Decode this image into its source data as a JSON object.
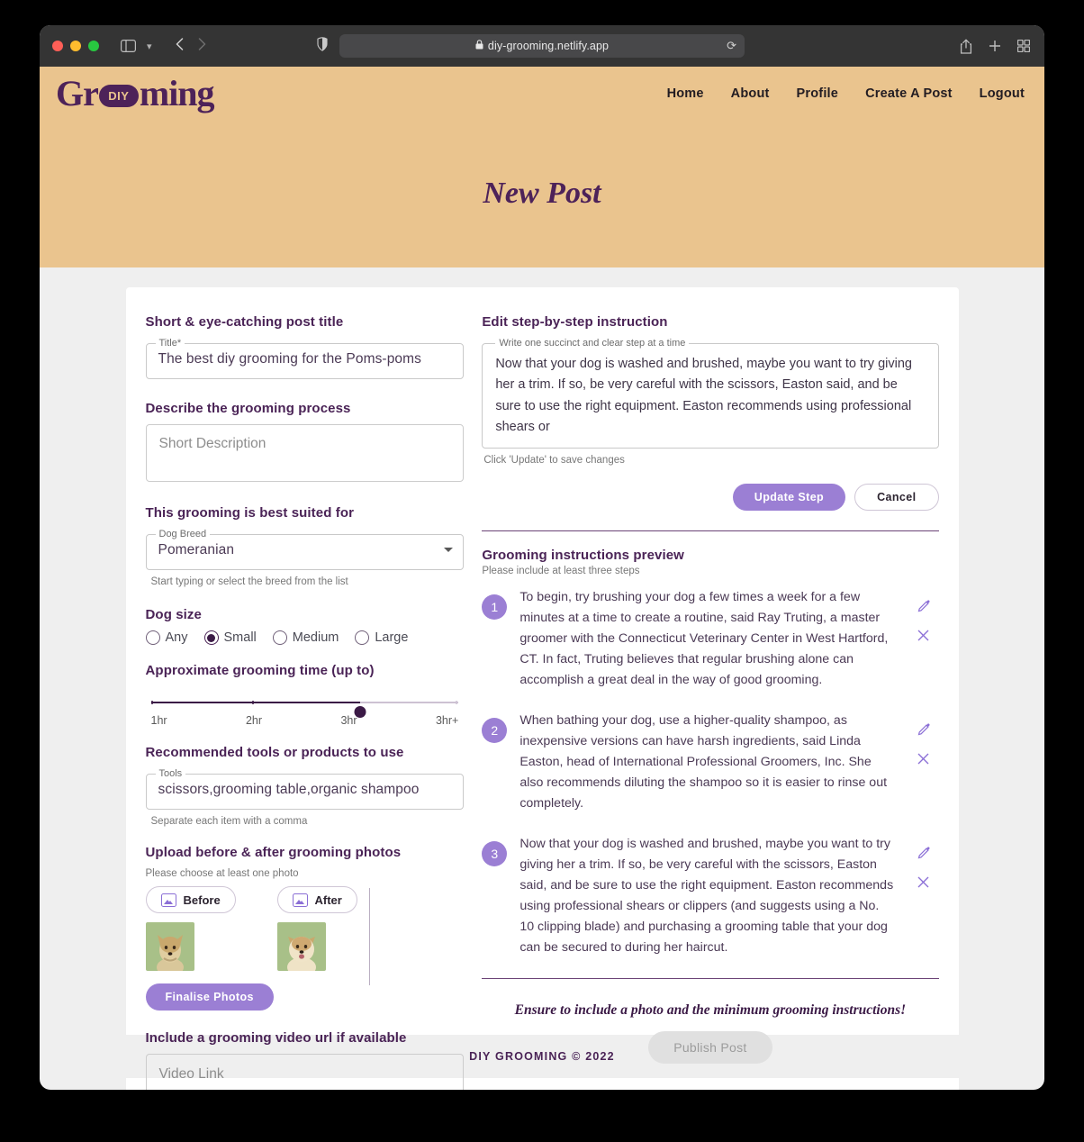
{
  "browser": {
    "url": "diy-grooming.netlify.app",
    "lock_icon": "lock-icon",
    "reload_icon": "reload-icon",
    "share_icon": "share-icon",
    "newtab_icon": "plus-icon",
    "tabs_icon": "tab-overview-icon",
    "sidebar_icon": "sidebar-toggle-icon",
    "back_icon": "back-arrow-icon",
    "forward_icon": "forward-arrow-icon",
    "shield_icon": "privacy-shield-icon"
  },
  "site": {
    "logo_part1": "Gr",
    "logo_badge": "DIY",
    "logo_part2": "ming",
    "nav": [
      {
        "label": "Home"
      },
      {
        "label": "About"
      },
      {
        "label": "Profile"
      },
      {
        "label": "Create A Post"
      },
      {
        "label": "Logout"
      }
    ],
    "hero_title": "New Post",
    "footer": "DIY GROOMING © 2022",
    "colors": {
      "header_bg": "#eac48e",
      "brand_purple": "#4d2259",
      "accent_purple": "#9b7fd4",
      "page_bg": "#efefef"
    }
  },
  "form": {
    "title_section": "Short & eye-catching post title",
    "title_legend": "Title*",
    "title_value": "The best diy grooming for the Poms-poms",
    "describe_section": "Describe the grooming process",
    "describe_placeholder": "Short Description",
    "breed_section": "This grooming is best suited for",
    "breed_legend": "Dog Breed",
    "breed_value": "Pomeranian",
    "breed_hint": "Start typing or select the breed from the list",
    "size_section": "Dog size",
    "size_options": [
      {
        "label": "Any",
        "checked": false
      },
      {
        "label": "Small",
        "checked": true
      },
      {
        "label": "Medium",
        "checked": false
      },
      {
        "label": "Large",
        "checked": false
      }
    ],
    "time_section": "Approximate grooming time (up to)",
    "time_ticks": [
      "1hr",
      "2hr",
      "3hr",
      "3hr+"
    ],
    "time_value": "3hr",
    "tools_section": "Recommended tools or products to use",
    "tools_legend": "Tools",
    "tools_value": "scissors,grooming table,organic shampoo",
    "tools_hint": "Separate each item with a comma",
    "photos_section": "Upload before & after grooming photos",
    "photos_hint": "Please choose at least one photo",
    "before_label": "Before",
    "after_label": "After",
    "finalise_label": "Finalise Photos",
    "video_section": "Include a grooming video url if available",
    "video_placeholder": "Video Link"
  },
  "editor": {
    "heading": "Edit step-by-step instruction",
    "legend": "Write one succinct and clear step at a time",
    "value": "Now that your dog is washed and brushed, maybe you want to try giving her a trim. If so, be very careful with the scissors, Easton said, and be sure to use the right equipment. Easton recommends using professional shears or",
    "hint": "Click 'Update' to save changes",
    "update_label": "Update Step",
    "cancel_label": "Cancel"
  },
  "preview": {
    "heading": "Grooming instructions preview",
    "hint": "Please include at least three steps",
    "steps": [
      {
        "number": "1",
        "text": "To begin, try brushing your dog a few times a week for a few minutes at a time to create a routine, said Ray Truting, a master groomer with the Connecticut Veterinary Center in West Hartford, CT. In fact, Truting believes that regular brushing alone can accomplish a great deal in the way of good grooming."
      },
      {
        "number": "2",
        "text": "When bathing your dog, use a higher-quality shampoo, as inexpensive versions can have harsh ingredients, said Linda Easton, head of International Professional Groomers, Inc. She also recommends diluting the shampoo so it is easier to rinse out completely."
      },
      {
        "number": "3",
        "text": "Now that your dog is washed and brushed, maybe you want to try giving her a trim. If so, be very careful with the scissors, Easton said, and be sure to use the right equipment. Easton recommends using professional shears or clippers (and suggests using a No. 10 clipping blade) and purchasing a grooming table that your dog can be secured to during her haircut."
      }
    ],
    "edit_icon": "pencil-icon",
    "delete_icon": "close-x-icon"
  },
  "publish": {
    "note": "Ensure to include a photo and the minimum grooming instructions!",
    "button_label": "Publish Post"
  }
}
